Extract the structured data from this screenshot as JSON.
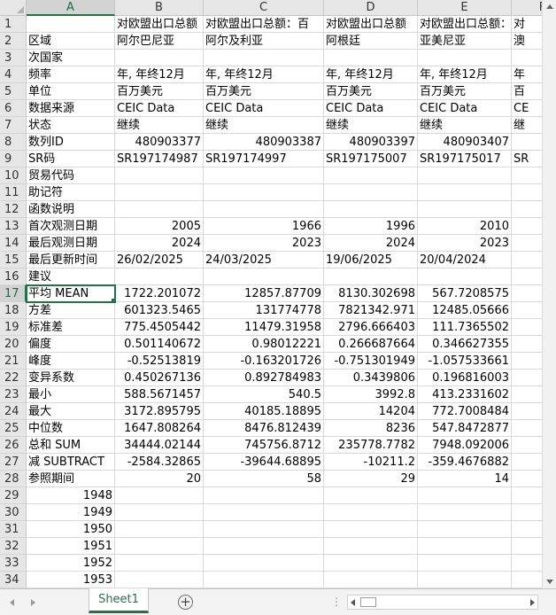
{
  "columns": [
    "A",
    "B",
    "C",
    "D",
    "E",
    "F"
  ],
  "selected_column": "A",
  "selected_row": 17,
  "rows": [
    {
      "n": 1,
      "cells": [
        "",
        "对欧盟出口总额",
        "对欧盟出口总额：百",
        "对欧盟出口总额",
        "对欧盟出口总额：",
        "对"
      ]
    },
    {
      "n": 2,
      "cells": [
        "区域",
        "阿尔巴尼亚",
        "阿尔及利亚",
        "阿根廷",
        "亚美尼亚",
        "澳"
      ]
    },
    {
      "n": 3,
      "cells": [
        "次国家",
        "",
        "",
        "",
        "",
        ""
      ]
    },
    {
      "n": 4,
      "cells": [
        "频率",
        "年, 年终12月",
        "年, 年终12月",
        "年, 年终12月",
        "年, 年终12月",
        "年"
      ]
    },
    {
      "n": 5,
      "cells": [
        "单位",
        "百万美元",
        "百万美元",
        "百万美元",
        "百万美元",
        "百"
      ]
    },
    {
      "n": 6,
      "cells": [
        "数据来源",
        "CEIC Data",
        "CEIC Data",
        "CEIC Data",
        "CEIC Data",
        "CE"
      ]
    },
    {
      "n": 7,
      "cells": [
        "状态",
        "继续",
        "继续",
        "继续",
        "继续",
        "继"
      ]
    },
    {
      "n": 8,
      "cells": [
        "数列ID",
        "480903377",
        "480903387",
        "480903397",
        "480903407",
        ""
      ]
    },
    {
      "n": 9,
      "cells": [
        "SR码",
        "SR197174987",
        "SR197174997",
        "SR197175007",
        "SR197175017",
        "SR"
      ]
    },
    {
      "n": 10,
      "cells": [
        "贸易代码",
        "",
        "",
        "",
        "",
        ""
      ]
    },
    {
      "n": 11,
      "cells": [
        "助记符",
        "",
        "",
        "",
        "",
        ""
      ]
    },
    {
      "n": 12,
      "cells": [
        "函数说明",
        "",
        "",
        "",
        "",
        ""
      ]
    },
    {
      "n": 13,
      "cells": [
        "首次观测日期",
        "2005",
        "1966",
        "1996",
        "2010",
        ""
      ]
    },
    {
      "n": 14,
      "cells": [
        "最后观测日期",
        "2024",
        "2023",
        "2024",
        "2023",
        ""
      ]
    },
    {
      "n": 15,
      "cells": [
        "最后更新时间",
        "26/02/2025",
        "24/03/2025",
        "19/06/2025",
        "20/04/2024",
        "07"
      ]
    },
    {
      "n": 16,
      "cells": [
        "建议",
        "",
        "",
        "",
        "",
        ""
      ]
    },
    {
      "n": 17,
      "cells": [
        "平均 MEAN",
        "1722.201072",
        "12857.87709",
        "8130.302698",
        "567.7208575",
        ""
      ]
    },
    {
      "n": 18,
      "cells": [
        "方差",
        "601323.5465",
        "131774778",
        "7821342.971",
        "12485.05666",
        ""
      ]
    },
    {
      "n": 19,
      "cells": [
        "标准差",
        "775.4505442",
        "11479.31958",
        "2796.666403",
        "111.7365502",
        ""
      ]
    },
    {
      "n": 20,
      "cells": [
        "偏度",
        "0.501140672",
        "0.98012221",
        "0.266687664",
        "0.346627355",
        ""
      ]
    },
    {
      "n": 21,
      "cells": [
        "峰度",
        "-0.52513819",
        "-0.163201726",
        "-0.751301949",
        "-1.057533661",
        ""
      ]
    },
    {
      "n": 22,
      "cells": [
        "变异系数",
        "0.450267136",
        "0.892784983",
        "0.3439806",
        "0.196816003",
        ""
      ]
    },
    {
      "n": 23,
      "cells": [
        "最小",
        "588.5671457",
        "540.5",
        "3992.8",
        "413.2331602",
        ""
      ]
    },
    {
      "n": 24,
      "cells": [
        "最大",
        "3172.895795",
        "40185.18895",
        "14204",
        "772.7008484",
        ""
      ]
    },
    {
      "n": 25,
      "cells": [
        "中位数",
        "1647.808264",
        "8476.812439",
        "8236",
        "547.8472877",
        ""
      ]
    },
    {
      "n": 26,
      "cells": [
        "总和 SUM",
        "34444.02144",
        "745756.8712",
        "235778.7782",
        "7948.092006",
        ""
      ]
    },
    {
      "n": 27,
      "cells": [
        "减 SUBTRACT",
        "-2584.32865",
        "-39644.68895",
        "-10211.2",
        "-359.4676882",
        ""
      ]
    },
    {
      "n": 28,
      "cells": [
        "参照期间",
        "20",
        "58",
        "29",
        "14",
        ""
      ]
    },
    {
      "n": 29,
      "cells": [
        "1948",
        "",
        "",
        "",
        "",
        ""
      ]
    },
    {
      "n": 30,
      "cells": [
        "1949",
        "",
        "",
        "",
        "",
        ""
      ]
    },
    {
      "n": 31,
      "cells": [
        "1950",
        "",
        "",
        "",
        "",
        ""
      ]
    },
    {
      "n": 32,
      "cells": [
        "1951",
        "",
        "",
        "",
        "",
        ""
      ]
    },
    {
      "n": 33,
      "cells": [
        "1952",
        "",
        "",
        "",
        "",
        ""
      ]
    },
    {
      "n": 34,
      "cells": [
        "1953",
        "",
        "",
        "",
        "",
        ""
      ]
    }
  ],
  "tabs": {
    "sheet_name": "Sheet1",
    "add_label": "+",
    "dots": "⋮"
  },
  "icons": {
    "prev": "chevron-left-icon",
    "next": "chevron-right-icon",
    "add": "plus-circle-icon"
  },
  "colors": {
    "accent": "#217346"
  }
}
